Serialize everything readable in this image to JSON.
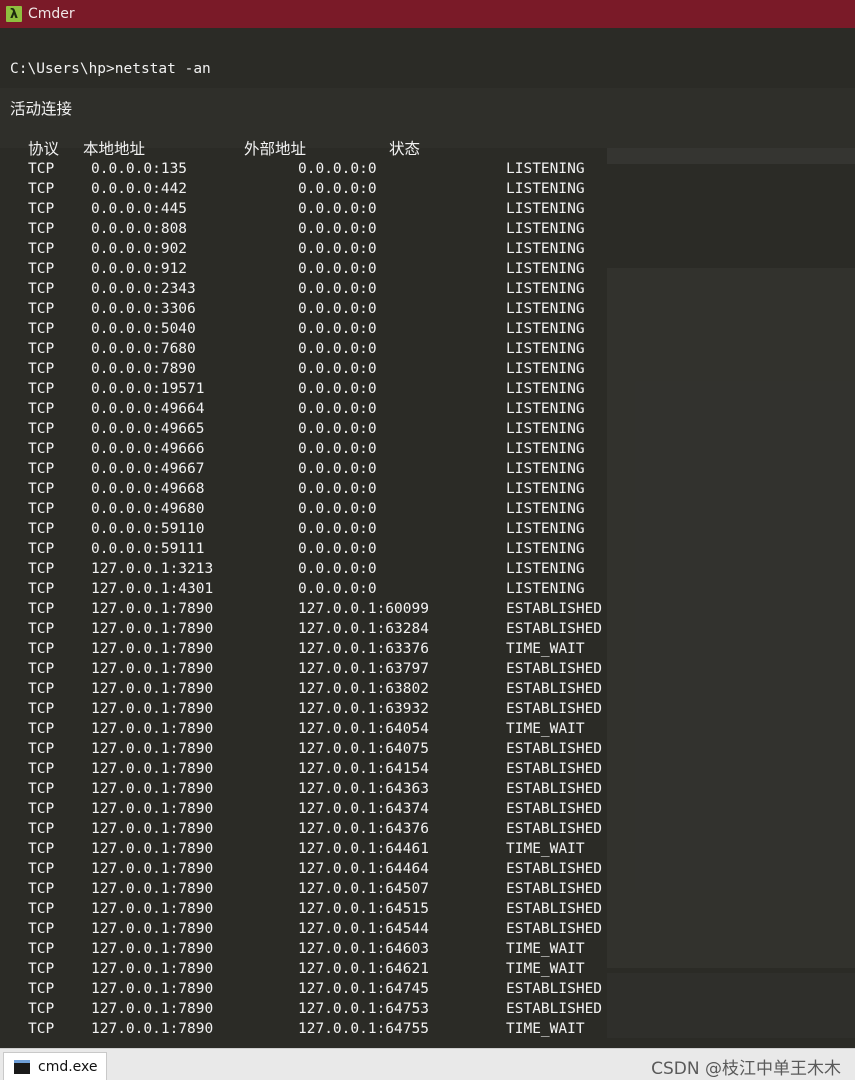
{
  "window": {
    "title": "Cmder",
    "app_icon": "λ"
  },
  "terminal": {
    "command_line": "C:\\Users\\hp>netstat -an",
    "section_title": "活动连接",
    "headers": {
      "proto": "协议",
      "local": "本地地址",
      "foreign": "外部地址",
      "state": "状态"
    },
    "rows": [
      [
        "TCP",
        "0.0.0.0:135",
        "0.0.0.0:0",
        "LISTENING"
      ],
      [
        "TCP",
        "0.0.0.0:442",
        "0.0.0.0:0",
        "LISTENING"
      ],
      [
        "TCP",
        "0.0.0.0:445",
        "0.0.0.0:0",
        "LISTENING"
      ],
      [
        "TCP",
        "0.0.0.0:808",
        "0.0.0.0:0",
        "LISTENING"
      ],
      [
        "TCP",
        "0.0.0.0:902",
        "0.0.0.0:0",
        "LISTENING"
      ],
      [
        "TCP",
        "0.0.0.0:912",
        "0.0.0.0:0",
        "LISTENING"
      ],
      [
        "TCP",
        "0.0.0.0:2343",
        "0.0.0.0:0",
        "LISTENING"
      ],
      [
        "TCP",
        "0.0.0.0:3306",
        "0.0.0.0:0",
        "LISTENING"
      ],
      [
        "TCP",
        "0.0.0.0:5040",
        "0.0.0.0:0",
        "LISTENING"
      ],
      [
        "TCP",
        "0.0.0.0:7680",
        "0.0.0.0:0",
        "LISTENING"
      ],
      [
        "TCP",
        "0.0.0.0:7890",
        "0.0.0.0:0",
        "LISTENING"
      ],
      [
        "TCP",
        "0.0.0.0:19571",
        "0.0.0.0:0",
        "LISTENING"
      ],
      [
        "TCP",
        "0.0.0.0:49664",
        "0.0.0.0:0",
        "LISTENING"
      ],
      [
        "TCP",
        "0.0.0.0:49665",
        "0.0.0.0:0",
        "LISTENING"
      ],
      [
        "TCP",
        "0.0.0.0:49666",
        "0.0.0.0:0",
        "LISTENING"
      ],
      [
        "TCP",
        "0.0.0.0:49667",
        "0.0.0.0:0",
        "LISTENING"
      ],
      [
        "TCP",
        "0.0.0.0:49668",
        "0.0.0.0:0",
        "LISTENING"
      ],
      [
        "TCP",
        "0.0.0.0:49680",
        "0.0.0.0:0",
        "LISTENING"
      ],
      [
        "TCP",
        "0.0.0.0:59110",
        "0.0.0.0:0",
        "LISTENING"
      ],
      [
        "TCP",
        "0.0.0.0:59111",
        "0.0.0.0:0",
        "LISTENING"
      ],
      [
        "TCP",
        "127.0.0.1:3213",
        "0.0.0.0:0",
        "LISTENING"
      ],
      [
        "TCP",
        "127.0.0.1:4301",
        "0.0.0.0:0",
        "LISTENING"
      ],
      [
        "TCP",
        "127.0.0.1:7890",
        "127.0.0.1:60099",
        "ESTABLISHED"
      ],
      [
        "TCP",
        "127.0.0.1:7890",
        "127.0.0.1:63284",
        "ESTABLISHED"
      ],
      [
        "TCP",
        "127.0.0.1:7890",
        "127.0.0.1:63376",
        "TIME_WAIT"
      ],
      [
        "TCP",
        "127.0.0.1:7890",
        "127.0.0.1:63797",
        "ESTABLISHED"
      ],
      [
        "TCP",
        "127.0.0.1:7890",
        "127.0.0.1:63802",
        "ESTABLISHED"
      ],
      [
        "TCP",
        "127.0.0.1:7890",
        "127.0.0.1:63932",
        "ESTABLISHED"
      ],
      [
        "TCP",
        "127.0.0.1:7890",
        "127.0.0.1:64054",
        "TIME_WAIT"
      ],
      [
        "TCP",
        "127.0.0.1:7890",
        "127.0.0.1:64075",
        "ESTABLISHED"
      ],
      [
        "TCP",
        "127.0.0.1:7890",
        "127.0.0.1:64154",
        "ESTABLISHED"
      ],
      [
        "TCP",
        "127.0.0.1:7890",
        "127.0.0.1:64363",
        "ESTABLISHED"
      ],
      [
        "TCP",
        "127.0.0.1:7890",
        "127.0.0.1:64374",
        "ESTABLISHED"
      ],
      [
        "TCP",
        "127.0.0.1:7890",
        "127.0.0.1:64376",
        "ESTABLISHED"
      ],
      [
        "TCP",
        "127.0.0.1:7890",
        "127.0.0.1:64461",
        "TIME_WAIT"
      ],
      [
        "TCP",
        "127.0.0.1:7890",
        "127.0.0.1:64464",
        "ESTABLISHED"
      ],
      [
        "TCP",
        "127.0.0.1:7890",
        "127.0.0.1:64507",
        "ESTABLISHED"
      ],
      [
        "TCP",
        "127.0.0.1:7890",
        "127.0.0.1:64515",
        "ESTABLISHED"
      ],
      [
        "TCP",
        "127.0.0.1:7890",
        "127.0.0.1:64544",
        "ESTABLISHED"
      ],
      [
        "TCP",
        "127.0.0.1:7890",
        "127.0.0.1:64603",
        "TIME_WAIT"
      ],
      [
        "TCP",
        "127.0.0.1:7890",
        "127.0.0.1:64621",
        "TIME_WAIT"
      ],
      [
        "TCP",
        "127.0.0.1:7890",
        "127.0.0.1:64745",
        "ESTABLISHED"
      ],
      [
        "TCP",
        "127.0.0.1:7890",
        "127.0.0.1:64753",
        "ESTABLISHED"
      ],
      [
        "TCP",
        "127.0.0.1:7890",
        "127.0.0.1:64755",
        "TIME_WAIT"
      ]
    ]
  },
  "taskbar": {
    "tab_label": "cmd.exe",
    "tab_icon": "cmd-icon",
    "watermark": "CSDN @枝江中单王木木"
  },
  "colors": {
    "titlebar": "#7a1a28",
    "terminal_bg": "#2b2b26",
    "text": "#f2f2f2",
    "taskbar": "#e9e9e9"
  }
}
